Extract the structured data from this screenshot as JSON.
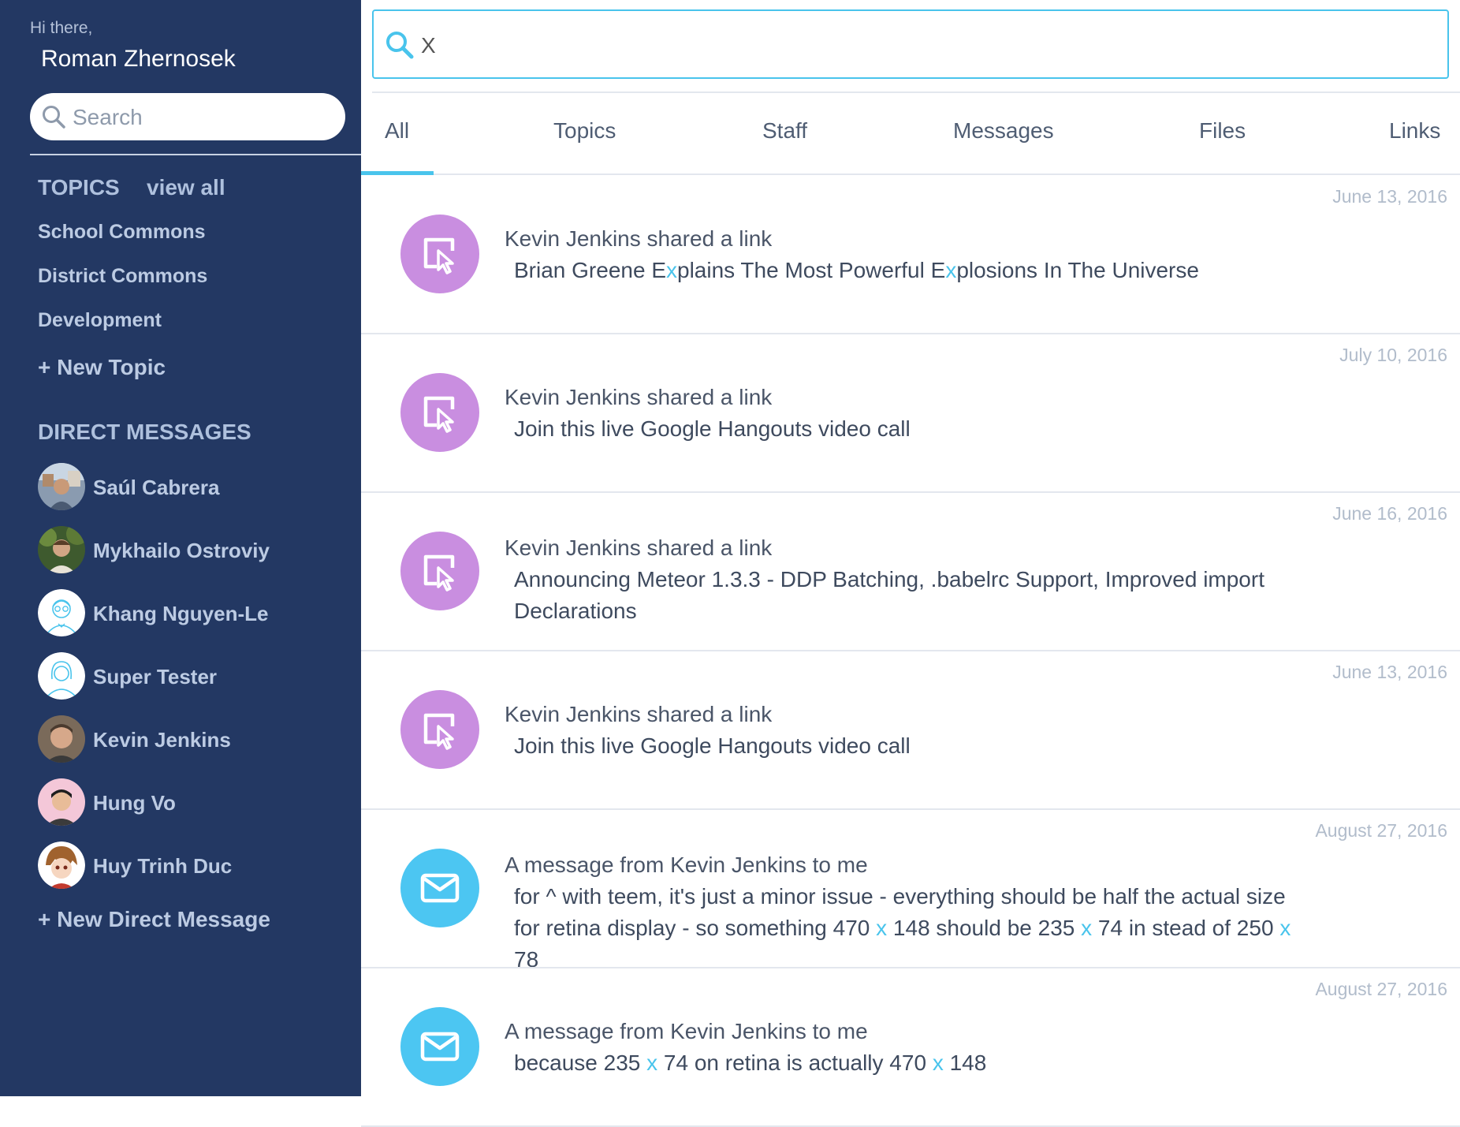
{
  "sidebar": {
    "greeting": "Hi there,",
    "username": "Roman Zhernosek",
    "search_placeholder": "Search",
    "topics_heading": "TOPICS",
    "view_all": "view all",
    "topics": [
      "School Commons",
      "District Commons",
      "Development"
    ],
    "new_topic": "+ New Topic",
    "dm_heading": "DIRECT MESSAGES",
    "direct_messages": [
      {
        "name": "Saúl Cabrera"
      },
      {
        "name": "Mykhailo Ostroviy"
      },
      {
        "name": "Khang Nguyen-Le"
      },
      {
        "name": "Super Tester"
      },
      {
        "name": "Kevin Jenkins"
      },
      {
        "name": "Hung Vo"
      },
      {
        "name": "Huy Trinh Duc"
      }
    ],
    "new_dm": "+ New Direct Message"
  },
  "search": {
    "query": "X"
  },
  "tabs": [
    "All",
    "Topics",
    "Staff",
    "Messages",
    "Files",
    "Links"
  ],
  "active_tab": "All",
  "colors": {
    "sidebar_bg": "#233863",
    "accent": "#49c4ec",
    "link_icon_bg": "#c98ee0",
    "message_icon_bg": "#4cc6f2"
  },
  "results": [
    {
      "type": "link",
      "icon": "link-cursor-icon",
      "date": "June 13, 2016",
      "title": "Kevin Jenkins shared a link",
      "body_parts": [
        {
          "t": "Brian Greene E"
        },
        {
          "t": "x",
          "hl": true
        },
        {
          "t": "plains The Most Powerful E"
        },
        {
          "t": "x",
          "hl": true
        },
        {
          "t": "plosions In The Universe"
        }
      ]
    },
    {
      "type": "link",
      "icon": "link-cursor-icon",
      "date": "July 10, 2016",
      "title": "Kevin Jenkins shared a link",
      "body_parts": [
        {
          "t": "Join this live Google Hangouts video call"
        }
      ]
    },
    {
      "type": "link",
      "icon": "link-cursor-icon",
      "date": "June 16, 2016",
      "title": "Kevin Jenkins shared a link",
      "body_parts": [
        {
          "t": "Announcing Meteor 1.3.3 - DDP Batching, .babelrc Support, Improved import Declarations"
        }
      ]
    },
    {
      "type": "link",
      "icon": "link-cursor-icon",
      "date": "June 13, 2016",
      "title": "Kevin Jenkins shared a link",
      "body_parts": [
        {
          "t": "Join this live Google Hangouts video call"
        }
      ]
    },
    {
      "type": "message",
      "icon": "envelope-icon",
      "date": "August 27, 2016",
      "title": "A message from Kevin Jenkins to me",
      "body_parts": [
        {
          "t": "for ^ with teem, it's just a minor issue - everything should be half the actual size for retina display - so something 470 "
        },
        {
          "t": "x",
          "hl": true
        },
        {
          "t": " 148 should be 235 "
        },
        {
          "t": "x",
          "hl": true
        },
        {
          "t": " 74 in stead of 250 "
        },
        {
          "t": "x",
          "hl": true
        },
        {
          "t": " 78"
        }
      ]
    },
    {
      "type": "message",
      "icon": "envelope-icon",
      "date": "August 27, 2016",
      "title": "A message from Kevin Jenkins to me",
      "body_parts": [
        {
          "t": "because 235 "
        },
        {
          "t": "x",
          "hl": true
        },
        {
          "t": " 74 on retina is actually 470 "
        },
        {
          "t": "x",
          "hl": true
        },
        {
          "t": " 148"
        }
      ]
    }
  ]
}
